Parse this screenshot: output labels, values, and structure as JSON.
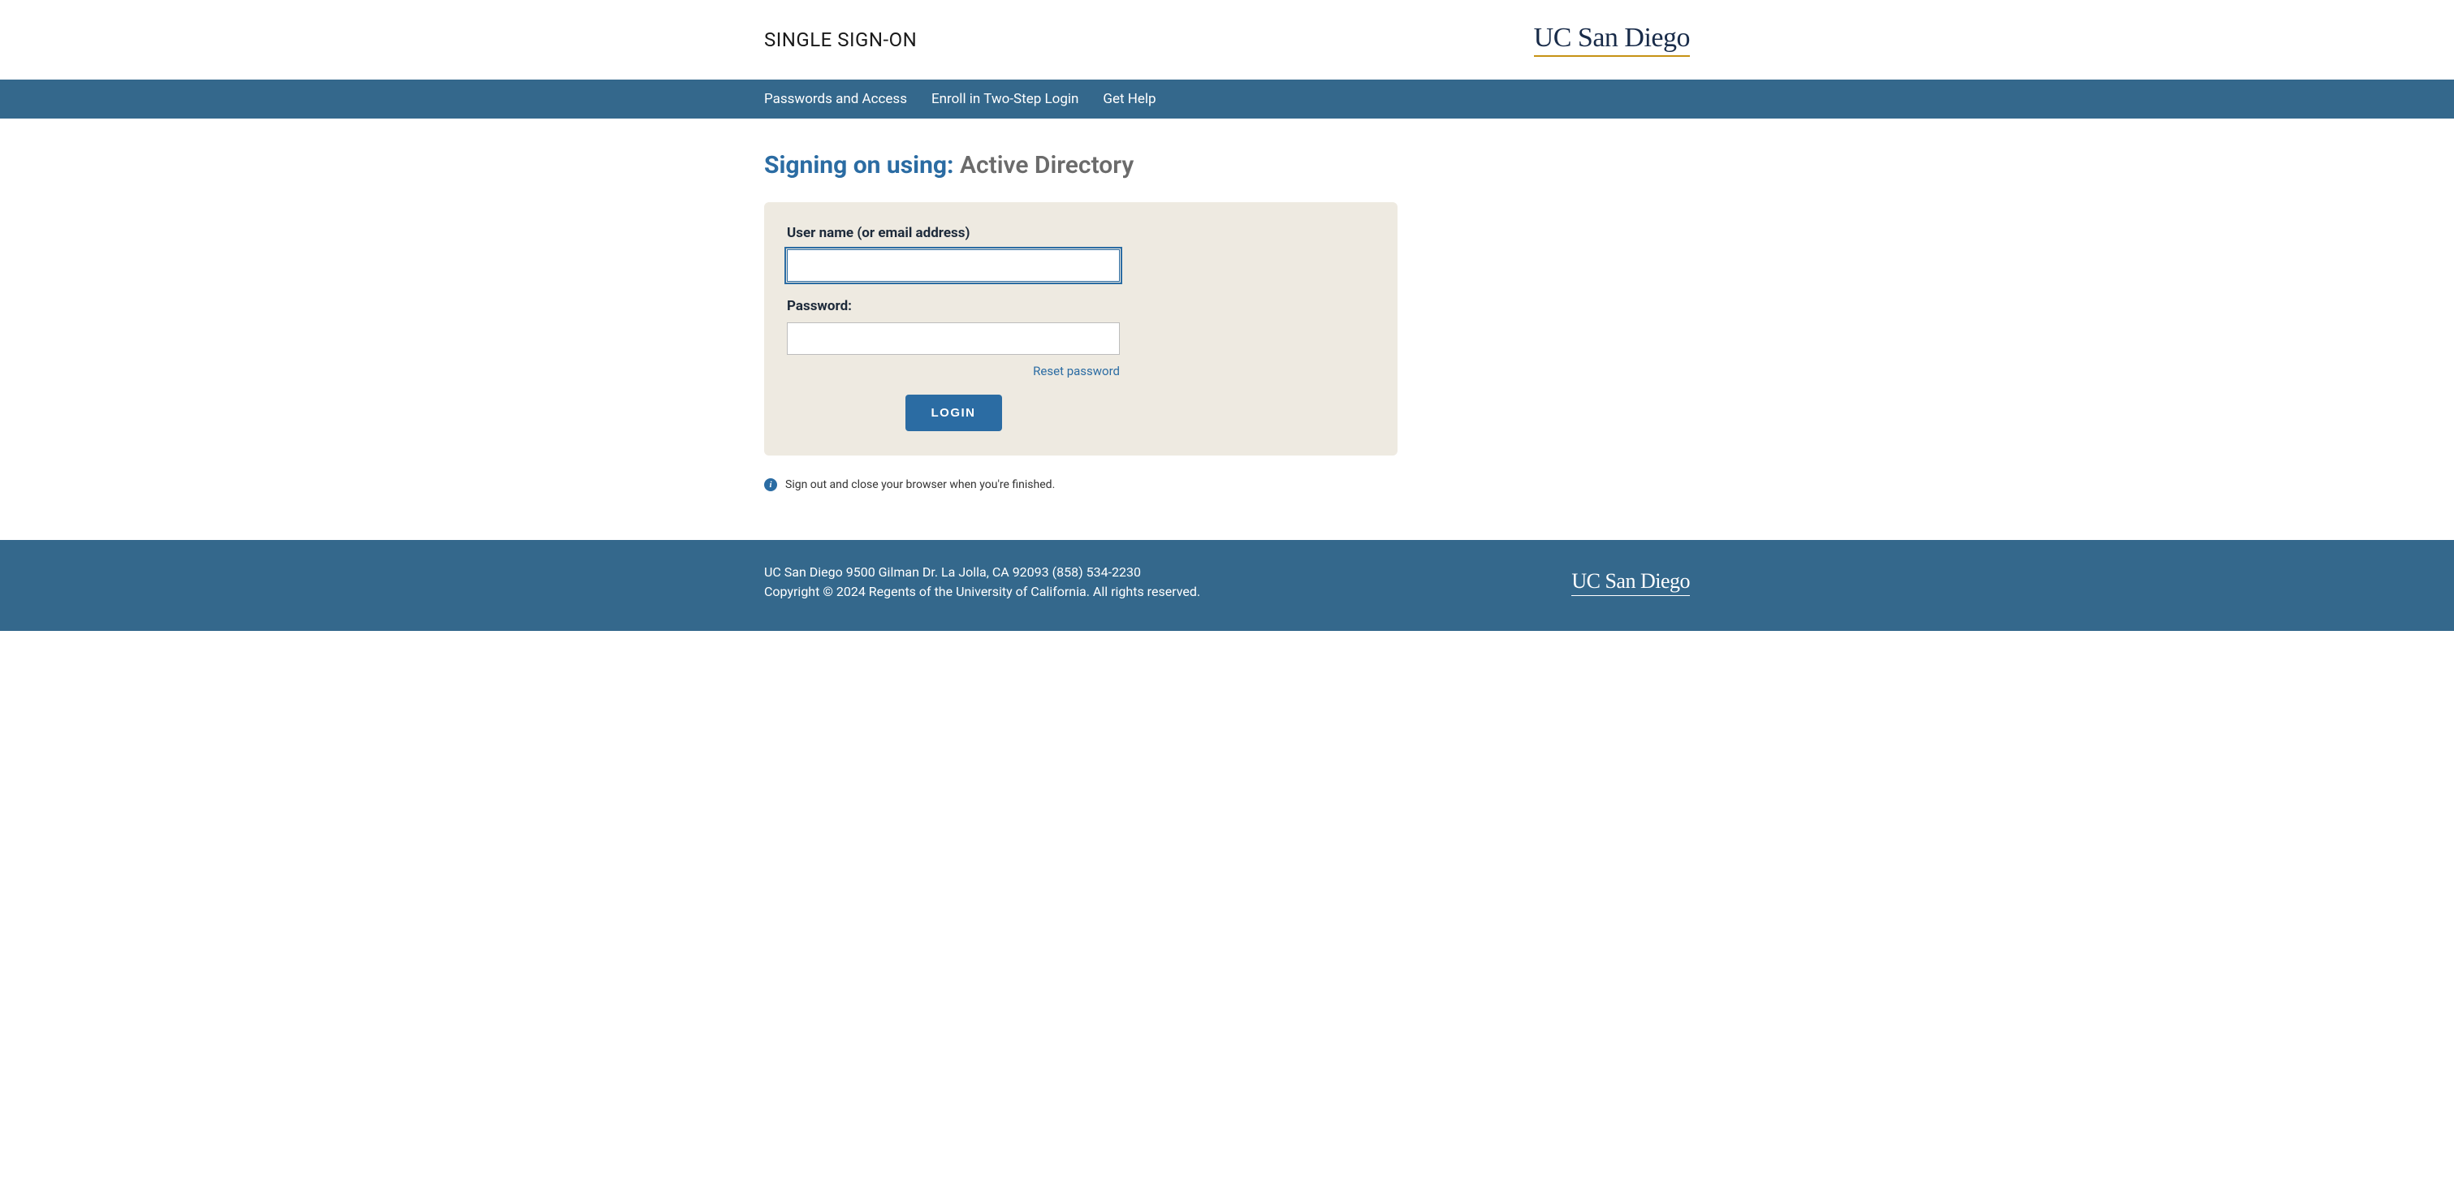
{
  "header": {
    "title": "SINGLE SIGN-ON",
    "logo_text": "UC San Diego"
  },
  "nav": {
    "items": [
      {
        "label": "Passwords and Access"
      },
      {
        "label": "Enroll in Two-Step Login"
      },
      {
        "label": "Get Help"
      }
    ]
  },
  "main": {
    "heading_prefix": "Signing on using:",
    "heading_service": "Active Directory",
    "form": {
      "username_label": "User name (or email address)",
      "username_value": "",
      "password_label": "Password:",
      "password_value": "",
      "reset_link": "Reset password",
      "login_button": "LOGIN"
    },
    "info_note": "Sign out and close your browser when you're finished."
  },
  "footer": {
    "address": "UC San Diego 9500 Gilman Dr. La Jolla, CA 92093 (858) 534-2230",
    "copyright": "Copyright © 2024 Regents of the University of California. All rights reserved.",
    "logo_text": "UC San Diego"
  }
}
